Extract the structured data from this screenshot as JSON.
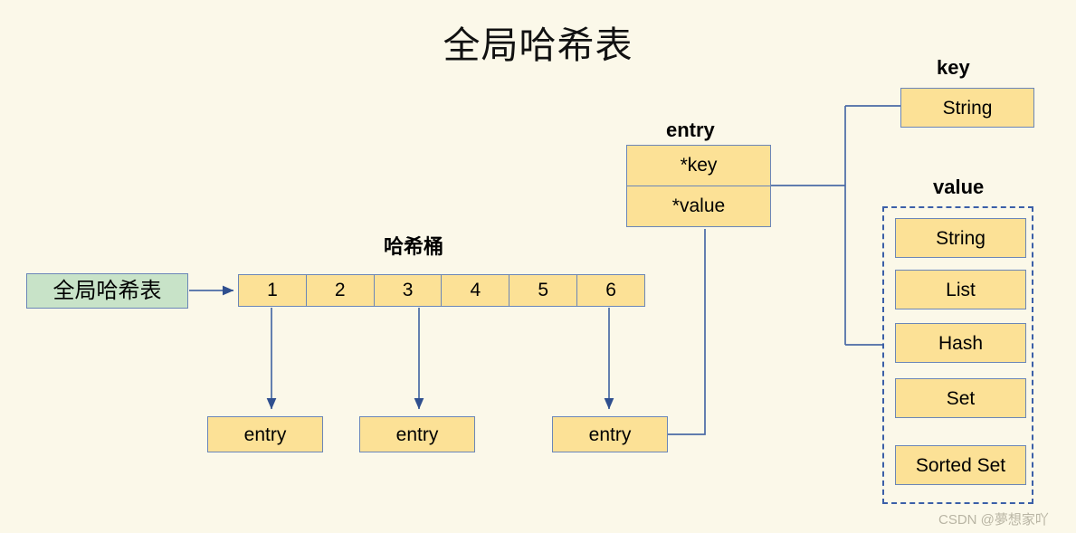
{
  "page": {
    "title": "全局哈希表",
    "background_color": "#fbf8e9",
    "box_fill": "#fce196",
    "box_stroke": "#6b86b8",
    "source_fill": "#c8e3c8",
    "dashed_stroke": "#3b5fa8",
    "watermark": "CSDN @夢想家吖"
  },
  "source": {
    "label": "全局哈希表"
  },
  "bucket": {
    "title": "哈希桶",
    "cells": [
      "1",
      "2",
      "3",
      "4",
      "5",
      "6"
    ],
    "linked_cells": [
      "1",
      "3",
      "6"
    ]
  },
  "entry_leaves": [
    {
      "label": "entry"
    },
    {
      "label": "entry"
    },
    {
      "label": "entry"
    }
  ],
  "entry_struct": {
    "title": "entry",
    "key_field": "*key",
    "value_field": "*value"
  },
  "key_group": {
    "title": "key",
    "types": [
      "String"
    ]
  },
  "value_group": {
    "title": "value",
    "types": [
      "String",
      "List",
      "Hash",
      "Set",
      "Sorted Set"
    ]
  }
}
